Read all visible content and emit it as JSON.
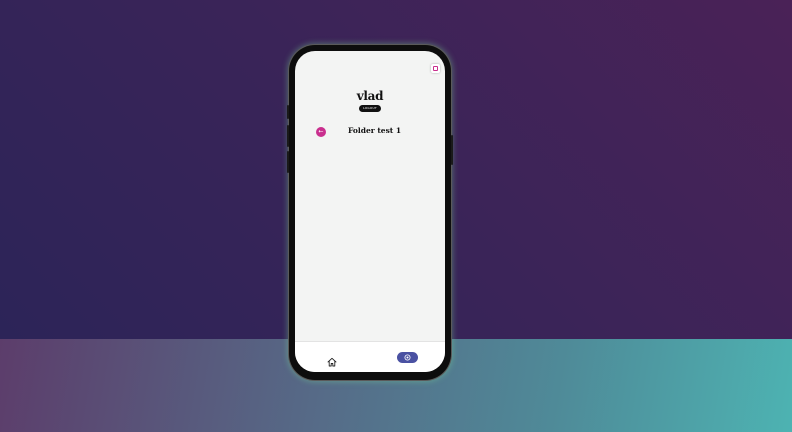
{
  "profile": {
    "username": "vlad",
    "logout_label": "LOGOUT"
  },
  "folder": {
    "title": "Folder test 1",
    "back_icon": "arrow-left-icon"
  },
  "header": {
    "corner_icon": "square-app-icon"
  },
  "bottom_nav": {
    "items": [
      {
        "icon": "home-icon",
        "active": false
      },
      {
        "icon": "target-icon",
        "active": true
      }
    ]
  },
  "colors": {
    "accent_pink": "#c92f8e",
    "nav_active": "#4a51a2",
    "screen_bg": "#f3f4f3"
  }
}
